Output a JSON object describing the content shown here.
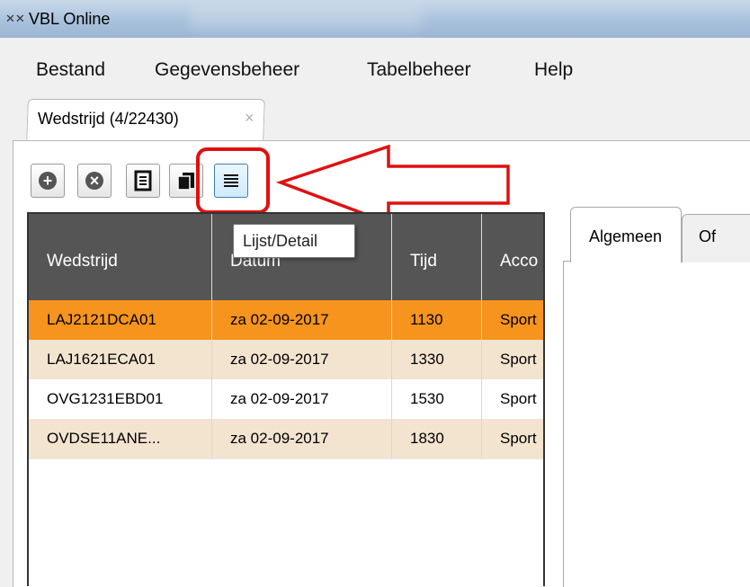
{
  "window": {
    "title": "VBL Online",
    "icon": "app-icon"
  },
  "menu": [
    "Bestand",
    "Gegevensbeheer",
    "Tabelbeheer",
    "Help"
  ],
  "file_tab": {
    "label": "Wedstrijd (4/22430)",
    "close": "×"
  },
  "toolbar": [
    {
      "name": "add-icon",
      "symbol": "+"
    },
    {
      "name": "remove-icon",
      "symbol": "×"
    },
    {
      "name": "document-icon",
      "symbol": ""
    },
    {
      "name": "copy-icon",
      "symbol": ""
    },
    {
      "name": "list-detail-icon",
      "symbol": "≡"
    }
  ],
  "tooltip": "Lijst/Detail",
  "grid": {
    "columns": [
      "Wedstrijd",
      "Datum",
      "Tijd",
      "Acco"
    ],
    "rows": [
      {
        "cells": [
          "LAJ2121DCA01",
          "za 02-09-2017",
          "1130",
          "Sport"
        ],
        "state": "selected"
      },
      {
        "cells": [
          "LAJ1621ECA01",
          "za 02-09-2017",
          "1330",
          "Sport"
        ],
        "state": "alt"
      },
      {
        "cells": [
          "OVG1231EBD01",
          "za 02-09-2017",
          "1530",
          "Sport"
        ],
        "state": "normal"
      },
      {
        "cells": [
          "OVDSE11ANE...",
          "za 02-09-2017",
          "1830",
          "Sport"
        ],
        "state": "alt"
      }
    ]
  },
  "detail_tabs": [
    "Algemeen",
    "Of"
  ],
  "colors": {
    "selected_row": "#f7941d",
    "alt_row": "#f3e4d0",
    "header": "#555555",
    "annotation": "#e01010"
  }
}
